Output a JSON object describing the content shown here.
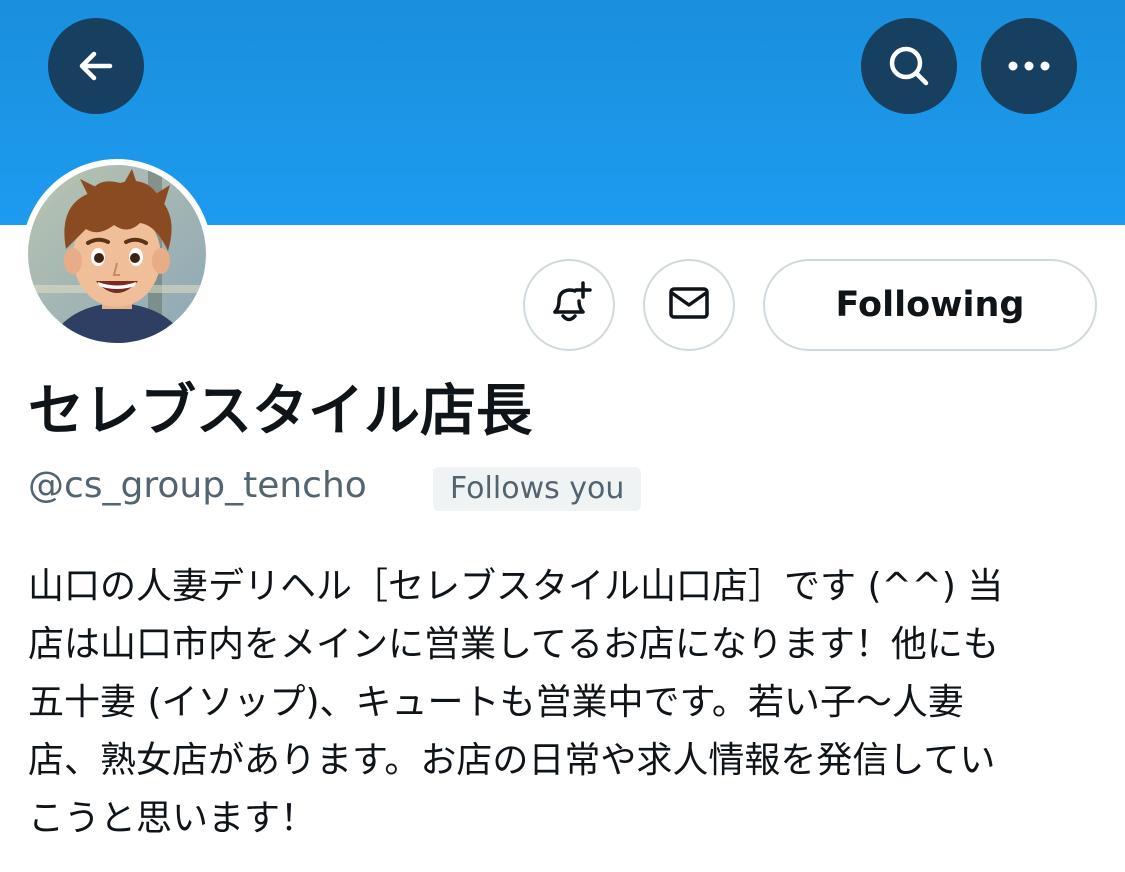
{
  "header": {
    "back_icon": "arrow-left-icon",
    "search_icon": "search-icon",
    "more_icon": "more-horizontal-icon",
    "banner_color": "#1d9bf0",
    "button_bg_color": "#173f5f"
  },
  "profile": {
    "avatar_description_icon": "avatar-image",
    "display_name": "セレブスタイル店長",
    "handle": "@cs_group_tencho",
    "follows_you_badge": "Follows you",
    "bio": "山口の人妻デリヘル［セレブスタイル山口店］です (^^) 当\n店は山口市内をメインに営業してるお店になります！他にも\n五十妻 (イソップ)、キュートも営業中です。若い子〜人妻\n店、熟女店があります。お店の日常や求人情報を発信してい\nこうと思います！"
  },
  "actions": {
    "notify_icon": "bell-plus-icon",
    "message_icon": "mail-icon",
    "following_label": "Following"
  }
}
